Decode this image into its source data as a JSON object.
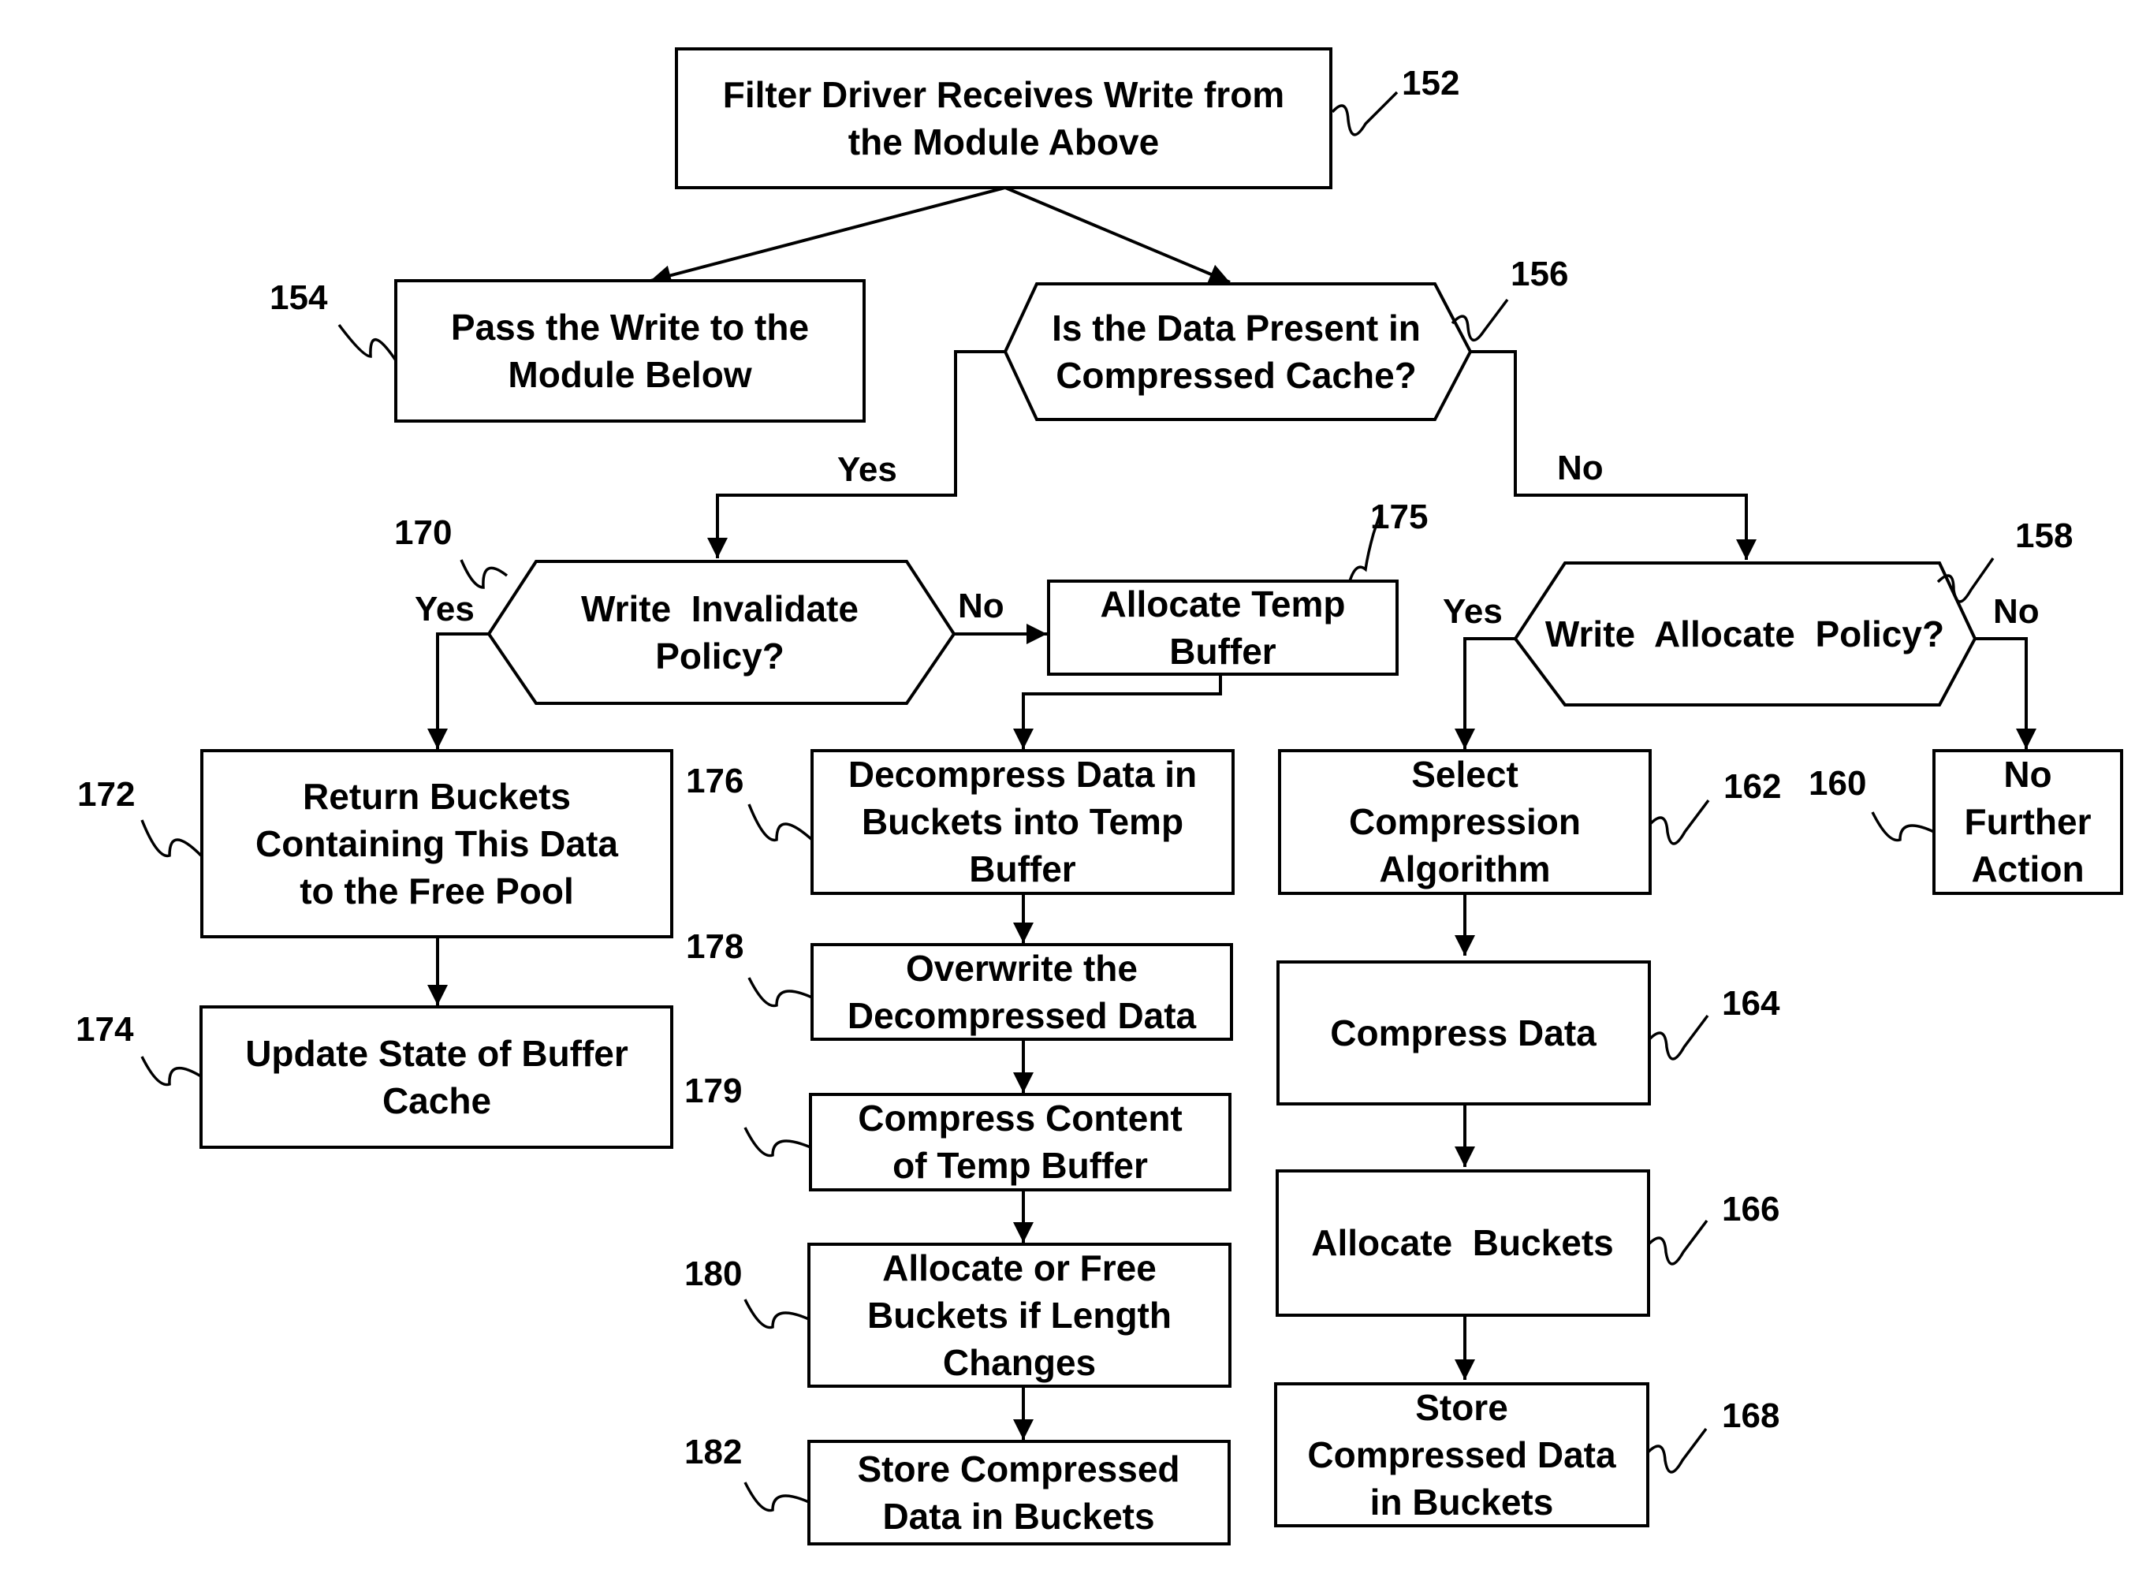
{
  "diagram": {
    "type": "flowchart",
    "nodes": [
      {
        "id": "152",
        "shape": "rect",
        "lines": [
          "Filter Driver Receives Write from",
          "the Module Above"
        ]
      },
      {
        "id": "154",
        "shape": "rect",
        "lines": [
          "Pass the Write to the",
          "Module Below"
        ]
      },
      {
        "id": "156",
        "shape": "hexagon",
        "lines": [
          "Is the Data Present in",
          "Compressed Cache?"
        ]
      },
      {
        "id": "170",
        "shape": "hexagon",
        "lines": [
          "Write  Invalidate",
          "Policy?"
        ]
      },
      {
        "id": "175",
        "shape": "rect",
        "lines": [
          "Allocate Temp",
          "Buffer"
        ]
      },
      {
        "id": "158",
        "shape": "hexagon",
        "lines": [
          "Write  Allocate  Policy?"
        ]
      },
      {
        "id": "172",
        "shape": "rect",
        "lines": [
          "Return Buckets",
          "Containing This Data",
          "to the Free Pool"
        ]
      },
      {
        "id": "174",
        "shape": "rect",
        "lines": [
          "Update State of Buffer",
          "Cache"
        ]
      },
      {
        "id": "176",
        "shape": "rect",
        "lines": [
          "Decompress Data in",
          "Buckets into Temp",
          "Buffer"
        ]
      },
      {
        "id": "178",
        "shape": "rect",
        "lines": [
          "Overwrite the",
          "Decompressed Data"
        ]
      },
      {
        "id": "179",
        "shape": "rect",
        "lines": [
          "Compress Content",
          "of Temp Buffer"
        ]
      },
      {
        "id": "180",
        "shape": "rect",
        "lines": [
          "Allocate or Free",
          "Buckets if Length",
          "Changes"
        ]
      },
      {
        "id": "182",
        "shape": "rect",
        "lines": [
          "Store Compressed",
          "Data in Buckets"
        ]
      },
      {
        "id": "162",
        "shape": "rect",
        "lines": [
          "Select",
          "Compression",
          "Algorithm"
        ]
      },
      {
        "id": "164",
        "shape": "rect",
        "lines": [
          "Compress Data"
        ]
      },
      {
        "id": "166",
        "shape": "rect",
        "lines": [
          "Allocate  Buckets"
        ]
      },
      {
        "id": "168",
        "shape": "rect",
        "lines": [
          "Store",
          "Compressed Data",
          "in Buckets"
        ]
      },
      {
        "id": "160",
        "shape": "rect",
        "lines": [
          "No",
          "Further",
          "Action"
        ]
      }
    ],
    "edges": [
      {
        "from": "152",
        "to": "154",
        "label": ""
      },
      {
        "from": "152",
        "to": "156",
        "label": ""
      },
      {
        "from": "156",
        "to": "170",
        "label": "Yes"
      },
      {
        "from": "156",
        "to": "158",
        "label": "No"
      },
      {
        "from": "170",
        "to": "172",
        "label": "Yes"
      },
      {
        "from": "170",
        "to": "175",
        "label": "No"
      },
      {
        "from": "172",
        "to": "174",
        "label": ""
      },
      {
        "from": "175",
        "to": "176",
        "label": ""
      },
      {
        "from": "176",
        "to": "178",
        "label": ""
      },
      {
        "from": "178",
        "to": "179",
        "label": ""
      },
      {
        "from": "179",
        "to": "180",
        "label": ""
      },
      {
        "from": "180",
        "to": "182",
        "label": ""
      },
      {
        "from": "158",
        "to": "162",
        "label": "Yes"
      },
      {
        "from": "158",
        "to": "160",
        "label": "No"
      },
      {
        "from": "162",
        "to": "164",
        "label": ""
      },
      {
        "from": "164",
        "to": "166",
        "label": ""
      },
      {
        "from": "166",
        "to": "168",
        "label": ""
      }
    ],
    "branch_labels": {
      "156_yes": "Yes",
      "156_no": "No",
      "170_yes": "Yes",
      "170_no": "No",
      "158_yes": "Yes",
      "158_no": "No"
    }
  }
}
